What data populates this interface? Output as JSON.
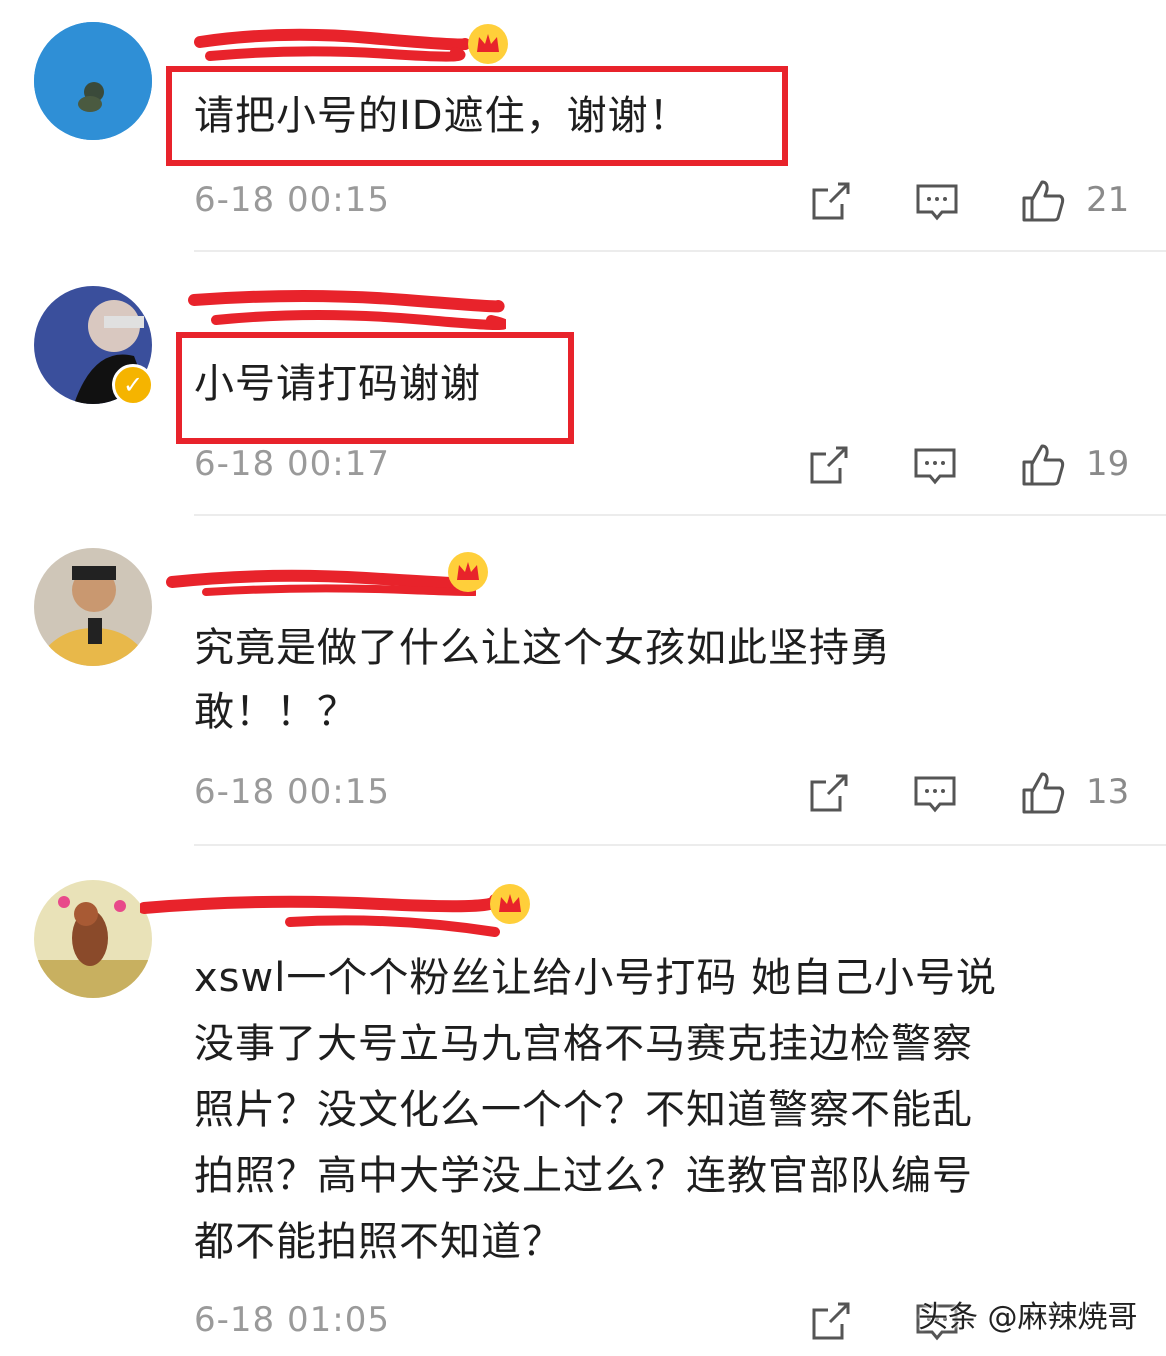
{
  "comments": [
    {
      "text": "请把小号的ID遮住，谢谢！",
      "time": "6-18 00:15",
      "likes": "21",
      "highlighted": true
    },
    {
      "text": "小号请打码谢谢",
      "time": "6-18 00:17",
      "likes": "19",
      "highlighted": true
    },
    {
      "text": "究竟是做了什么让这个女孩如此坚持勇敢！！？",
      "line1": "究竟是做了什么让这个女孩如此坚持勇",
      "line2": "敢！！？",
      "time": "6-18 00:15",
      "likes": "13",
      "highlighted": false
    },
    {
      "lines": [
        "xswl一个个粉丝让给小号打码 她自己小号说",
        "没事了大号立马九宫格不马赛克挂边检警察",
        "照片？没文化么一个个？不知道警察不能乱",
        "拍照？高中大学没上过么？连教官部队编号",
        "都不能拍照不知道？"
      ],
      "time": "6-18 01:05",
      "likes": "",
      "highlighted": false
    }
  ],
  "watermark": {
    "text": "头条 @麻辣焼哥"
  },
  "colors": {
    "highlight": "#e8232b",
    "redact": "#e8232b",
    "meta": "#9a9a9a",
    "verified": "#f5b400"
  },
  "icons": [
    "share-icon",
    "comment-icon",
    "like-icon",
    "crown-icon",
    "verified-icon"
  ]
}
